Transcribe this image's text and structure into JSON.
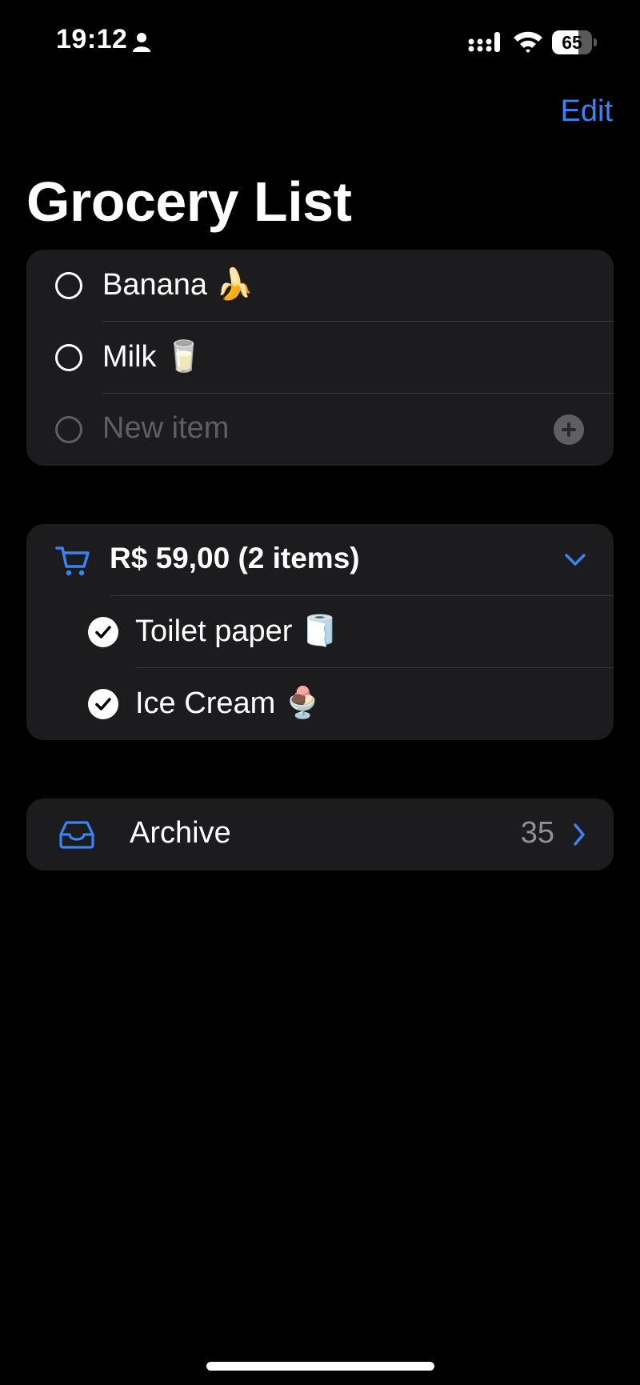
{
  "status_bar": {
    "time": "19:12",
    "battery_percent": "65",
    "battery_level": 0.65
  },
  "nav": {
    "edit_label": "Edit"
  },
  "page": {
    "title": "Grocery List"
  },
  "list": {
    "items": [
      {
        "label": "Banana 🍌",
        "checked": false
      },
      {
        "label": "Milk 🥛",
        "checked": false
      }
    ],
    "new_item_placeholder": "New item"
  },
  "cart": {
    "summary": "R$ 59,00 (2 items)",
    "items": [
      {
        "label": "Toilet paper 🧻",
        "checked": true
      },
      {
        "label": "Ice Cream 🍨",
        "checked": true
      }
    ]
  },
  "archive": {
    "label": "Archive",
    "count": "35"
  },
  "colors": {
    "accent": "#3b82f6",
    "card_bg": "#1c1c1e",
    "background": "#000000",
    "muted": "#8e8e93"
  }
}
